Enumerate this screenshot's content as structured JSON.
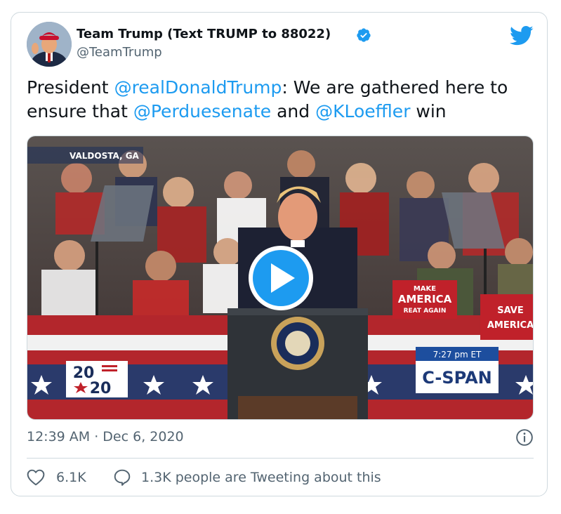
{
  "tweet": {
    "display_name": "Team Trump (Text TRUMP to 88022)",
    "handle": "@TeamTrump",
    "text_parts": [
      "President ",
      "@realDonaldTrump",
      ": We are gathered here to ensure that ",
      "@Perduesenate",
      " and ",
      "@KLoeffler",
      " win"
    ],
    "timestamp": "12:39 AM · Dec 6, 2020",
    "like_count": "6.1K",
    "reply_text": "1.3K people are Tweeting about this"
  },
  "video": {
    "location_label": "VALDOSTA, GA",
    "time_label": "7:27 pm ET",
    "network_label": "C-SPAN",
    "logo_top": "20",
    "logo_bottom": "20",
    "sign_main": "MAKE",
    "sign_mid": "AMERICA",
    "sign_bottom": "REAT AGAIN",
    "sign_save": "SAVE",
    "sign_save2": "AMERICA"
  },
  "colors": {
    "accent": "#1d9bf0",
    "text": "#0f1419",
    "muted": "#536471",
    "border": "#cfd9de",
    "verified": "#1d9bf0"
  },
  "icons": {
    "verified": "verified-badge-icon",
    "logo": "twitter-bird-icon",
    "info": "info-icon",
    "like": "heart-icon",
    "reply": "speech-bubble-icon",
    "play": "play-icon"
  }
}
